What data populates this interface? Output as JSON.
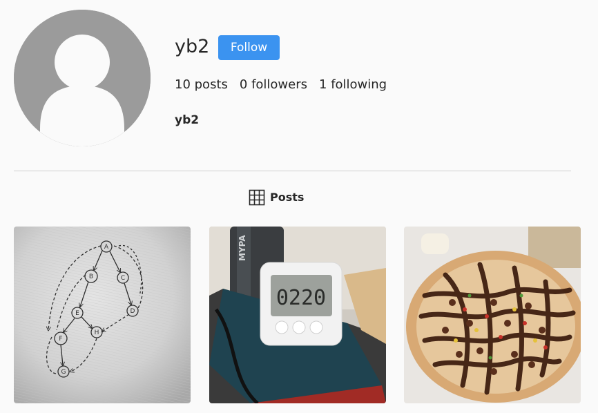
{
  "profile": {
    "username": "yb2",
    "follow_label": "Follow",
    "display_name": "yb2",
    "stats": {
      "posts": "10 posts",
      "followers": "0 followers",
      "following": "1 following"
    }
  },
  "tabs": {
    "posts_label": "Posts",
    "posts_icon": "grid-icon"
  },
  "posts": [
    {
      "photo": "hand-drawn graph diagram on paper"
    },
    {
      "photo": "digital timer on notebook"
    },
    {
      "photo": "pizza with sauce"
    }
  ],
  "diagram_nodes": [
    "A",
    "B",
    "C",
    "D",
    "E",
    "F",
    "H",
    "G"
  ],
  "timer_reading": "0220",
  "colors": {
    "accent": "#3b93f0",
    "avatar": "#9b9b9b",
    "divider": "#cfcfcf",
    "background": "#fafafa"
  }
}
